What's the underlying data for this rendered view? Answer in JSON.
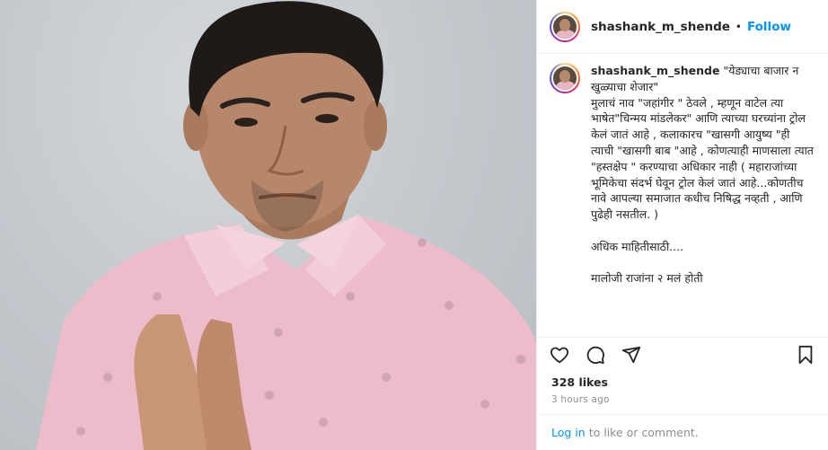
{
  "post": {
    "username": "shashank_m_shende",
    "separator": "•",
    "follow_label": "Follow",
    "caption_user": "shashank_m_shende",
    "caption_text": " \"येड्याचा बाजार न खुळ्याचा शेजार\"\nमुलाचं नाव \"जहांगीर \" ठेवले , म्हणून वाटेल त्या भाषेत\"चिन्मय मांडलेकर\" आणि त्याच्या घरच्यांना ट्रोल केलं जातं आहे , कलाकारच \"खासगी आयुष्य \"ही त्याची \"खासगी बाब \"आहे , कोणत्याही माणसाला त्यात \"हस्तक्षेप \" करण्याचा अधिकार नाही ( महाराजांच्या भूमिकेचा संदर्भ घेवून ट्रोल केलं जातं आहे...कोणतीच नावे आपल्या समाजात कधीच निषिद्ध नव्हती , आणि पुढेही नसतील. )\n\nअधिक माहितीसाठी....\n\nमालोजी राजांना २ मलं होती",
    "likes": "328 likes",
    "time": "3 hours ago",
    "login_link": "Log in",
    "login_rest": "to like or comment."
  },
  "icons": {
    "like": "heart-icon",
    "comment": "comment-icon",
    "share": "send-icon",
    "save": "bookmark-icon"
  },
  "colors": {
    "accent": "#0095f6",
    "text": "#262626",
    "muted": "#8e8e8e",
    "border": "#efefef",
    "shirt": "#e9b8c6"
  }
}
